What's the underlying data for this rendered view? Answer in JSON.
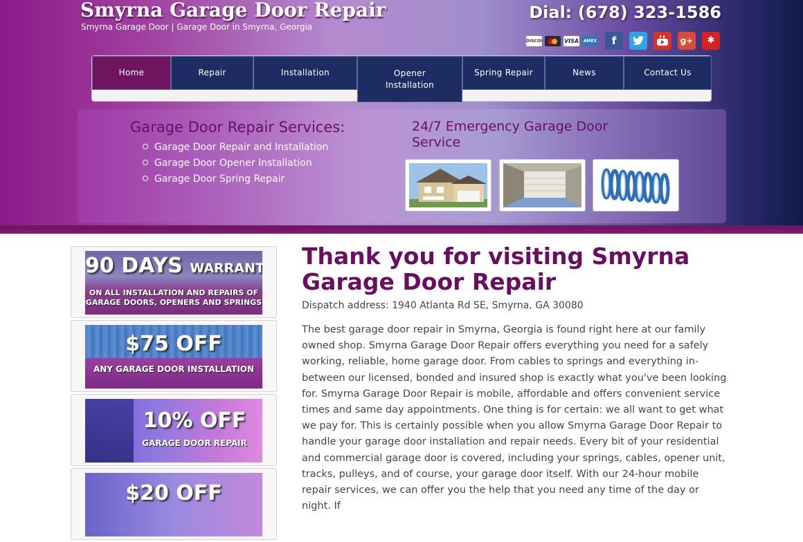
{
  "header": {
    "site_title": "Smyrna Garage Door Repair",
    "site_subtitle": "Smyrna Garage Door | Garage Door in Smyrna, Georgia",
    "phone": "Dial: (678) 323-1586",
    "payment_icons": [
      "discover-card-icon",
      "mastercard-icon",
      "visa-card-icon",
      "amex-card-icon"
    ],
    "payment_labels": {
      "discover": "DISCOVER",
      "visa": "VISA",
      "amex": "AMEX"
    },
    "social_icons": [
      {
        "name": "facebook-icon",
        "glyph": "f",
        "color": "#3b5998"
      },
      {
        "name": "twitter-icon",
        "glyph": "t",
        "color": "#2ea6e6"
      },
      {
        "name": "youtube-icon",
        "glyph": "You Tube",
        "color": "#d8312a"
      },
      {
        "name": "google-plus-icon",
        "glyph": "g+",
        "color": "#d94a38"
      },
      {
        "name": "yelp-icon",
        "glyph": "✱",
        "color": "#d32323"
      }
    ]
  },
  "nav": {
    "items": [
      {
        "label": "Home",
        "active": true
      },
      {
        "label": "Repair"
      },
      {
        "label": "Installation"
      },
      {
        "label": "Opener Installation"
      },
      {
        "label": "Spring Repair"
      },
      {
        "label": "News"
      },
      {
        "label": "Contact Us"
      }
    ]
  },
  "feature": {
    "services_heading": "Garage Door Repair Services:",
    "services": [
      "Garage Door Repair and Installation",
      "Garage Door Opener Installation",
      "Garage Door Spring Repair"
    ],
    "emergency_heading": "24/7 Emergency Garage Door Service",
    "thumbnails": [
      "house-thumbnail",
      "garage-interior-thumbnail",
      "spring-thumbnail"
    ]
  },
  "sidebar": {
    "promos": [
      {
        "big": "90 DAYS",
        "big_suffix": "WARRANTY",
        "small": "ON ALL INSTALLATION AND REPAIRS OF GARAGE DOORS, OPENERS AND SPRINGS"
      },
      {
        "big": "$75 OFF",
        "small": "ANY GARAGE DOOR INSTALLATION"
      },
      {
        "big": "10% OFF",
        "small": "GARAGE DOOR REPAIR"
      },
      {
        "big": "$20 OFF",
        "small": ""
      }
    ]
  },
  "main": {
    "title": "Thank you for visiting Smyrna Garage Door Repair",
    "address": "Dispatch address: 1940 Atlanta Rd SE, Smyrna, GA 30080",
    "body": "The best garage door repair in Smyrna, Georgia is found right here at our family owned shop. Smyrna Garage Door Repair offers everything you need for a safely working, reliable, home garage door. From cables to springs and everything in-between our licensed, bonded and insured shop is exactly what you've been looking for. Smyrna Garage Door Repair is mobile, affordable and offers convenient service times and same day appointments. One thing is for certain: we all want to get what we pay for. This is certainly possible when you allow Smyrna Garage Door Repair to handle your garage door installation and repair needs. Every bit of your residential and commercial garage door is covered, including your springs, cables, opener unit, tracks, pulleys, and of course, your garage door itself. With our 24-hour mobile repair services, we can offer you the help that you need any time of the day or night. If"
  }
}
